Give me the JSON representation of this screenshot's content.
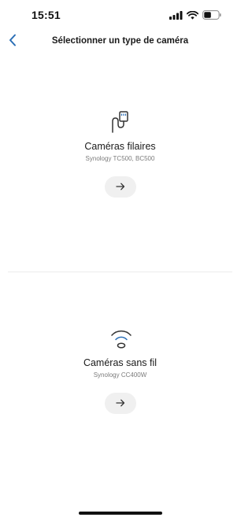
{
  "status_bar": {
    "time": "15:51",
    "icons": [
      "signal-icon",
      "wifi-icon",
      "battery-icon"
    ]
  },
  "header": {
    "back_icon": "chevron-left-icon",
    "title": "Sélectionner un type de caméra"
  },
  "options": [
    {
      "icon": "wired-camera-icon",
      "title": "Caméras filaires",
      "subtitle": "Synology TC500, BC500",
      "button_icon": "arrow-right-icon"
    },
    {
      "icon": "wifi-camera-icon",
      "title": "Caméras sans fil",
      "subtitle": "Synology CC400W",
      "button_icon": "arrow-right-icon"
    }
  ],
  "colors": {
    "accent": "#2b6fb6",
    "text": "#1a1a1a",
    "muted": "#7b7b7b",
    "button_bg": "#f0f0f0"
  }
}
